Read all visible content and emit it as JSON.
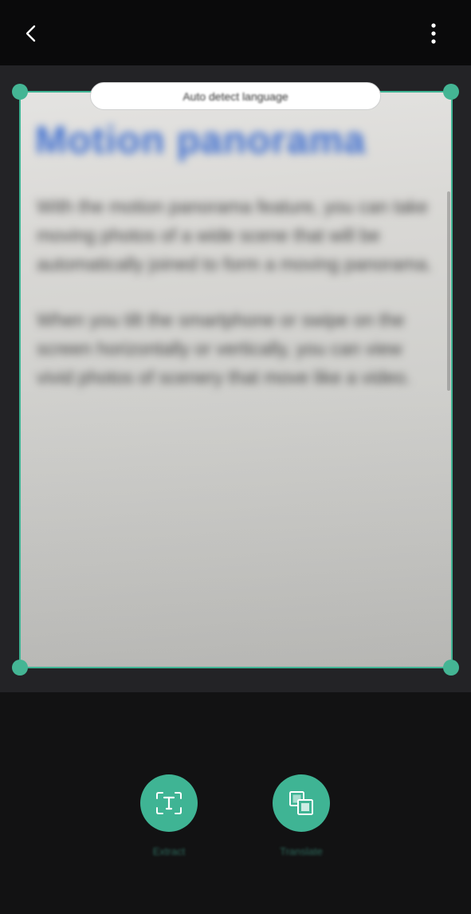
{
  "header": {
    "back_icon": "chevron-left-icon",
    "more_icon": "more-vertical-icon"
  },
  "language_selector": {
    "label": "Auto detect language"
  },
  "document": {
    "heading": "Motion panorama",
    "paragraphs": [
      "With the motion panorama feature, you can take\nmoving photos of a wide scene that will be\nautomatically joined to form a moving panorama.",
      "When you tilt the smartphone or swipe on the\nscreen horizontally or vertically, you can view\nvivid photos of scenery that move like a video."
    ]
  },
  "actions": [
    {
      "label": "Extract",
      "icon": "text-extract-icon"
    },
    {
      "label": "Translate",
      "icon": "translate-icon"
    }
  ],
  "colors": {
    "accent": "#3fb494",
    "topbar": "#0a0a0b",
    "camera_bg": "#232326",
    "heading_blue": "#3f6fd0"
  }
}
